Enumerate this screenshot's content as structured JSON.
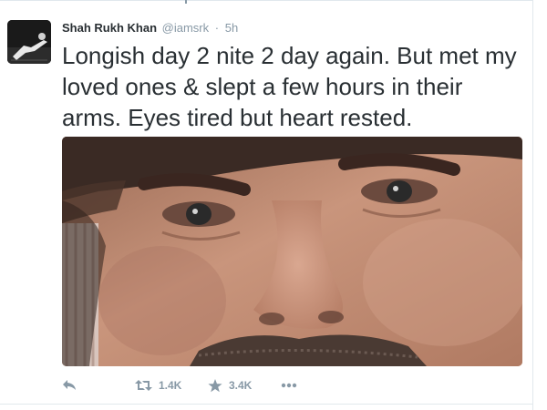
{
  "tweet": {
    "author": {
      "display_name": "Shah Rukh Khan",
      "username": "@iamsrk",
      "avatar_icon": "profile-photo"
    },
    "separator": "·",
    "timestamp": "5h",
    "text": "Longish day 2 nite 2 day again. But met my loved ones & slept a few hours in their arms. Eyes tired but heart rested.",
    "media": {
      "type": "photo",
      "icon": "selfie-photo"
    },
    "actions": {
      "reply": {
        "icon": "reply-icon"
      },
      "retweet": {
        "icon": "retweet-icon",
        "count": "1.4K"
      },
      "favorite": {
        "icon": "star-icon",
        "count": "3.4K"
      },
      "more": {
        "icon": "more-icon"
      }
    }
  },
  "colors": {
    "text": "#292f33",
    "muted": "#8899a6",
    "border": "#e1e8ed",
    "background": "#ffffff"
  }
}
